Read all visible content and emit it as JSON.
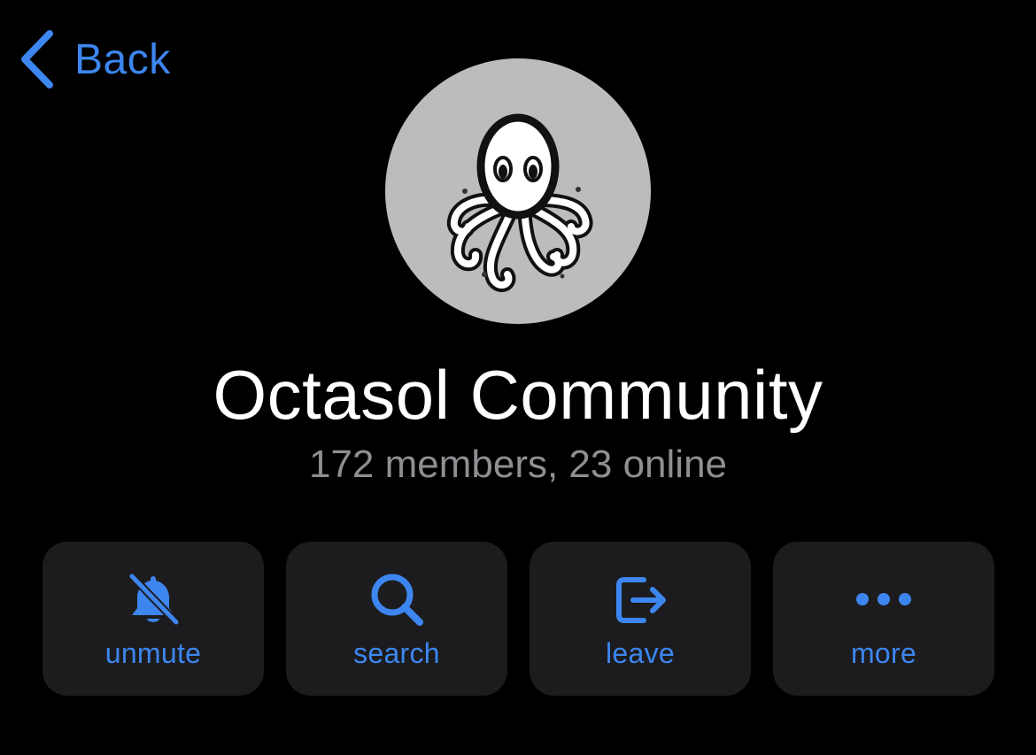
{
  "nav": {
    "back_label": "Back",
    "back_icon": "chevron-left-icon"
  },
  "profile": {
    "avatar_icon": "octopus-logo",
    "title": "Octasol Community",
    "subtitle": "172 members, 23 online"
  },
  "actions": [
    {
      "id": "unmute",
      "label": "unmute",
      "icon": "bell-slash-icon"
    },
    {
      "id": "search",
      "label": "search",
      "icon": "magnifier-icon"
    },
    {
      "id": "leave",
      "label": "leave",
      "icon": "leave-arrow-icon"
    },
    {
      "id": "more",
      "label": "more",
      "icon": "ellipsis-icon"
    }
  ],
  "colors": {
    "background": "#000000",
    "accent": "#3d86f0",
    "card": "#1c1c1e",
    "subtitle": "#8e8e93",
    "avatar_bg": "#bcbcbc"
  }
}
